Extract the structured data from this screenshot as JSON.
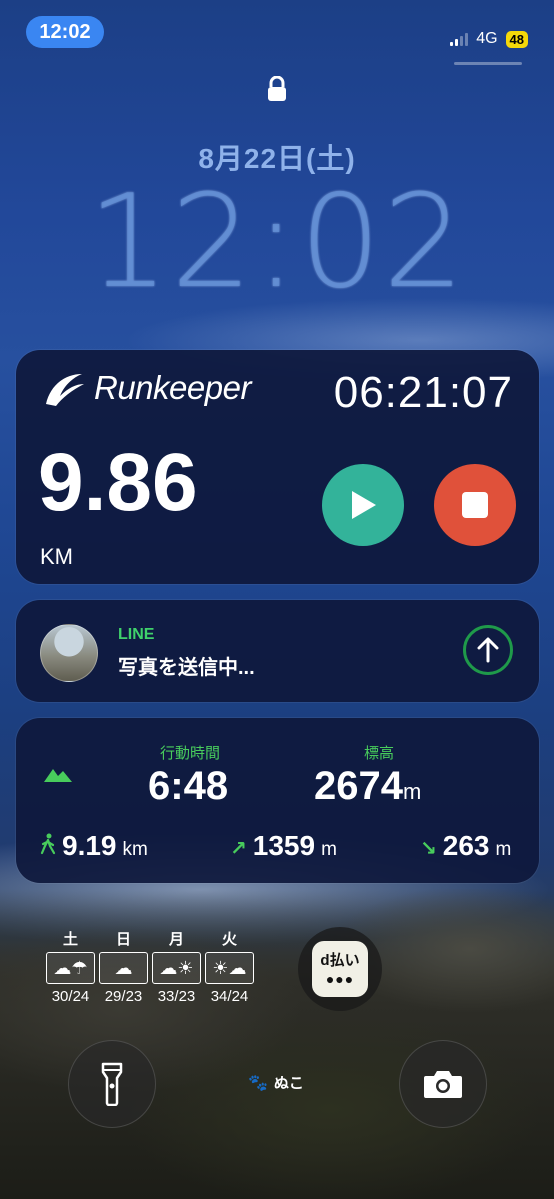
{
  "status_bar": {
    "time": "12:02",
    "network": "4G",
    "battery": "48"
  },
  "lock_screen": {
    "date": "8月22日(土)",
    "time": "12:02"
  },
  "runkeeper": {
    "app_name": "Runkeeper",
    "elapsed": "06:21:07",
    "distance": "9.86",
    "distance_unit": "KM",
    "play_icon": "play-icon",
    "stop_icon": "stop-icon",
    "colors": {
      "play": "#33b39a",
      "stop": "#e0513a"
    }
  },
  "line": {
    "app": "LINE",
    "message": "写真を送信中...",
    "upload_icon": "upload-arrow-icon"
  },
  "tracker": {
    "moving_time_label": "行動時間",
    "moving_time": "6:48",
    "elevation_label": "標高",
    "elevation": "2674",
    "elevation_unit": "m",
    "walk_distance": "9.19",
    "walk_distance_unit": "km",
    "ascent": "1359",
    "ascent_unit": "m",
    "descent": "263",
    "descent_unit": "m"
  },
  "weather": [
    {
      "day": "土",
      "icon": "cloud-rain-icon",
      "temps": "30/24"
    },
    {
      "day": "日",
      "icon": "cloud-icon",
      "temps": "29/23"
    },
    {
      "day": "月",
      "icon": "cloud-sun-icon",
      "temps": "33/23"
    },
    {
      "day": "火",
      "icon": "sun-cloud-icon",
      "temps": "34/24"
    }
  ],
  "dpay": {
    "label": "d払い",
    "dots": "●●●"
  },
  "footer": {
    "name": "ぬこ"
  }
}
